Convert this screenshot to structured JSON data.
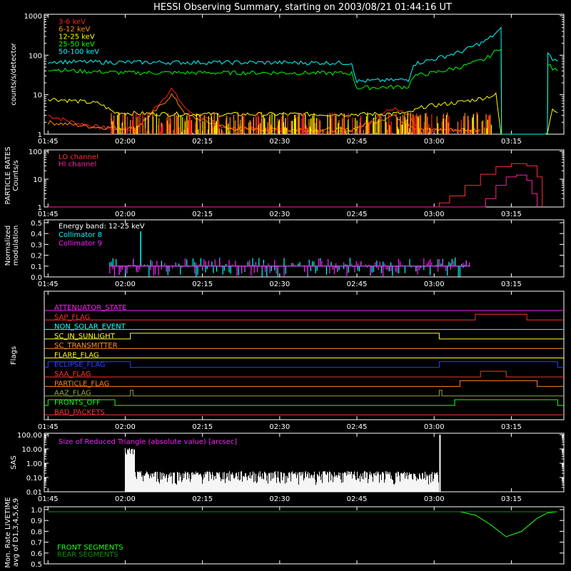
{
  "title": "HESSI Observing Summary, starting on 2003/08/21 01:44:16 UT",
  "time_ticks": [
    "01:45",
    "02:00",
    "02:15",
    "02:30",
    "02:45",
    "03:00",
    "03:15"
  ],
  "chart_data": [
    {
      "id": "countrates",
      "type": "line",
      "ylabel": "counts/s/detector",
      "yscale": "log",
      "ylim": [
        1,
        1000
      ],
      "ytick_labels": [
        "1",
        "10",
        "100",
        "1000"
      ],
      "series": [
        {
          "name": "3-6 keV",
          "color": "#ff2020",
          "x": [
            "01:45",
            "01:50",
            "01:55",
            "02:02",
            "02:06",
            "02:09",
            "02:12",
            "02:20",
            "02:30",
            "02:44",
            "02:48",
            "02:52",
            "02:55",
            "02:57",
            "03:05",
            "03:09"
          ],
          "y": [
            3,
            2,
            1.5,
            1.3,
            5,
            14,
            4,
            1.4,
            1.3,
            1.2,
            2.5,
            4.5,
            3,
            1.3,
            1.2,
            1.2
          ]
        },
        {
          "name": "6-12 keV",
          "color": "#ff8c00",
          "x": [
            "01:45",
            "01:55",
            "02:02",
            "02:06",
            "02:09",
            "02:12",
            "02:20",
            "02:30",
            "02:44",
            "02:52",
            "02:57",
            "03:05",
            "03:09"
          ],
          "y": [
            2,
            1.5,
            1.4,
            4,
            10,
            3,
            1.4,
            1.3,
            1.3,
            3,
            1.3,
            1.3,
            1.3
          ]
        },
        {
          "name": "12-25 keV",
          "color": "#ffff00",
          "x": [
            "01:45",
            "01:50",
            "01:55",
            "01:58",
            "02:05",
            "02:15",
            "02:30",
            "02:44",
            "02:46",
            "02:55",
            "02:58",
            "03:05",
            "03:09",
            "03:12",
            "03:13",
            "03:22",
            "03:23",
            "03:24"
          ],
          "y": [
            8,
            7,
            6,
            3.5,
            3.3,
            3.2,
            3.2,
            3.2,
            3.2,
            3.4,
            5,
            6.5,
            8,
            10,
            1,
            1,
            4.5,
            3.5
          ]
        },
        {
          "name": "25-50 keV",
          "color": "#00ff00",
          "x": [
            "01:45",
            "01:50",
            "02:00",
            "02:15",
            "02:30",
            "02:44",
            "02:45",
            "02:55",
            "02:56",
            "03:00",
            "03:05",
            "03:10",
            "03:13",
            "03:13.1",
            "03:22",
            "03:22.1",
            "03:23",
            "03:24"
          ],
          "y": [
            45,
            40,
            36,
            36,
            36,
            35,
            15,
            16,
            30,
            36,
            50,
            80,
            160,
            1,
            1,
            60,
            45,
            40
          ]
        },
        {
          "name": "50-100 keV",
          "color": "#00ffff",
          "x": [
            "01:45",
            "01:50",
            "02:00",
            "02:15",
            "02:30",
            "02:44",
            "02:45",
            "02:55",
            "02:56",
            "03:00",
            "03:05",
            "03:10",
            "03:13",
            "03:13.1",
            "03:22",
            "03:22.1",
            "03:23",
            "03:24"
          ],
          "y": [
            70,
            68,
            66,
            66,
            65,
            64,
            22,
            24,
            60,
            80,
            120,
            230,
            450,
            1,
            1,
            110,
            80,
            70
          ]
        }
      ]
    },
    {
      "id": "particles",
      "type": "line",
      "ylabel": "PARTICLE RATES Counts/s",
      "yscale": "log",
      "ylim": [
        1,
        100
      ],
      "ytick_labels": [
        "1",
        "10",
        "100"
      ],
      "series": [
        {
          "name": "LO channel",
          "color": "#ff3030",
          "x": [
            "01:45",
            "02:00",
            "02:30",
            "03:00",
            "03:01",
            "03:03",
            "03:06",
            "03:09",
            "03:12",
            "03:15",
            "03:18",
            "03:20",
            "03:21"
          ],
          "y": [
            1,
            1,
            1,
            1,
            1.4,
            2.5,
            6,
            15,
            28,
            36,
            30,
            12,
            1
          ]
        },
        {
          "name": "HI channel",
          "color": "#ff20a0",
          "x": [
            "01:45",
            "03:08",
            "03:10",
            "03:12",
            "03:14",
            "03:16",
            "03:18",
            "03:19",
            "03:20"
          ],
          "y": [
            1,
            1,
            2,
            6,
            12,
            14,
            9,
            3,
            1
          ]
        }
      ]
    },
    {
      "id": "modulation",
      "type": "bar",
      "ylabel": "Normalized modulation",
      "ylim": [
        0,
        0.5
      ],
      "ytick_labels": [
        "0.0",
        "0.1",
        "0.2",
        "0.3",
        "0.4",
        "0.5"
      ],
      "annotation": "Energy band: 12-25 keV",
      "series": [
        {
          "name": "Collimator 8",
          "color": "#00ffff",
          "x_range": [
            "01:57",
            "03:07"
          ],
          "baseline": 0.1,
          "peak_x": "02:03",
          "peak_y": 0.42
        },
        {
          "name": "Collimator 9",
          "color": "#ff20ff",
          "x_range": [
            "01:57",
            "03:07"
          ],
          "baseline": 0.1
        }
      ]
    },
    {
      "id": "flags",
      "type": "table",
      "ylabel": "Flags",
      "items": [
        {
          "name": "ATTENUATOR_STATE",
          "color": "#ff20ff",
          "steps": []
        },
        {
          "name": "SAP_FLAG",
          "color": "#ff3030",
          "steps": [
            [
              "03:08",
              "03:18"
            ]
          ]
        },
        {
          "name": "NON_SOLAR_EVENT",
          "color": "#20ffff",
          "steps": []
        },
        {
          "name": "SC_IN_SUNLIGHT",
          "color": "#ffff30",
          "steps": [
            [
              "02:01",
              "03:01"
            ]
          ]
        },
        {
          "name": "SC_TRANSMITTER",
          "color": "#ff9030",
          "steps": []
        },
        {
          "name": "FLARE_FLAG",
          "color": "#ffff00",
          "steps": []
        },
        {
          "name": "ECLIPSE_FLAG",
          "color": "#3040ff",
          "steps": [
            [
              "01:45",
              "02:01"
            ],
            [
              "03:01",
              "03:24"
            ]
          ]
        },
        {
          "name": "SAA_FLAG",
          "color": "#ff3030",
          "steps": [
            [
              "03:09",
              "03:14"
            ]
          ]
        },
        {
          "name": "PARTICLE_FLAG",
          "color": "#ff8020",
          "steps": [
            [
              "03:05",
              "03:20"
            ]
          ]
        },
        {
          "name": "AAZ_FLAG",
          "color": "#a0a040",
          "steps": [
            [
              "02:01",
              "02:01.5"
            ],
            [
              "03:01",
              "03:01.5"
            ]
          ]
        },
        {
          "name": "FRONTS_OFF",
          "color": "#20ff20",
          "steps": [
            [
              "01:45",
              "01:58"
            ],
            [
              "03:04",
              "03:24"
            ]
          ]
        },
        {
          "name": "BAD_PACKETS",
          "color": "#ff3030",
          "steps": []
        }
      ]
    },
    {
      "id": "sas",
      "type": "bar",
      "ylabel": "SAS",
      "yscale": "log",
      "ylim": [
        0.01,
        100
      ],
      "ytick_labels": [
        "0.01",
        "0.10",
        "1.00",
        "10.00",
        "100.00"
      ],
      "annotation": "Size of Reduced Triangle (absolute value) [arcsec]",
      "color": "#ffffff"
    },
    {
      "id": "livetime",
      "type": "line",
      "ylabel": "Mon. Rate LIVETIME avg of D1,3,4,5,6,9",
      "ylim": [
        0.5,
        1.0
      ],
      "ytick_labels": [
        "0.5",
        "0.6",
        "0.7",
        "0.8",
        "0.9",
        "1.0"
      ],
      "series": [
        {
          "name": "FRONT SEGMENTS",
          "color": "#20ff20",
          "x": [
            "01:45",
            "03:05",
            "03:08",
            "03:11",
            "03:14",
            "03:17",
            "03:20",
            "03:22",
            "03:24"
          ],
          "y": [
            0.98,
            0.98,
            0.95,
            0.86,
            0.75,
            0.8,
            0.92,
            0.97,
            0.98
          ]
        },
        {
          "name": "REAR SEGMENTS",
          "color": "#109010",
          "x": [
            "01:45",
            "03:24"
          ],
          "y": [
            0.98,
            0.98
          ]
        }
      ]
    }
  ]
}
